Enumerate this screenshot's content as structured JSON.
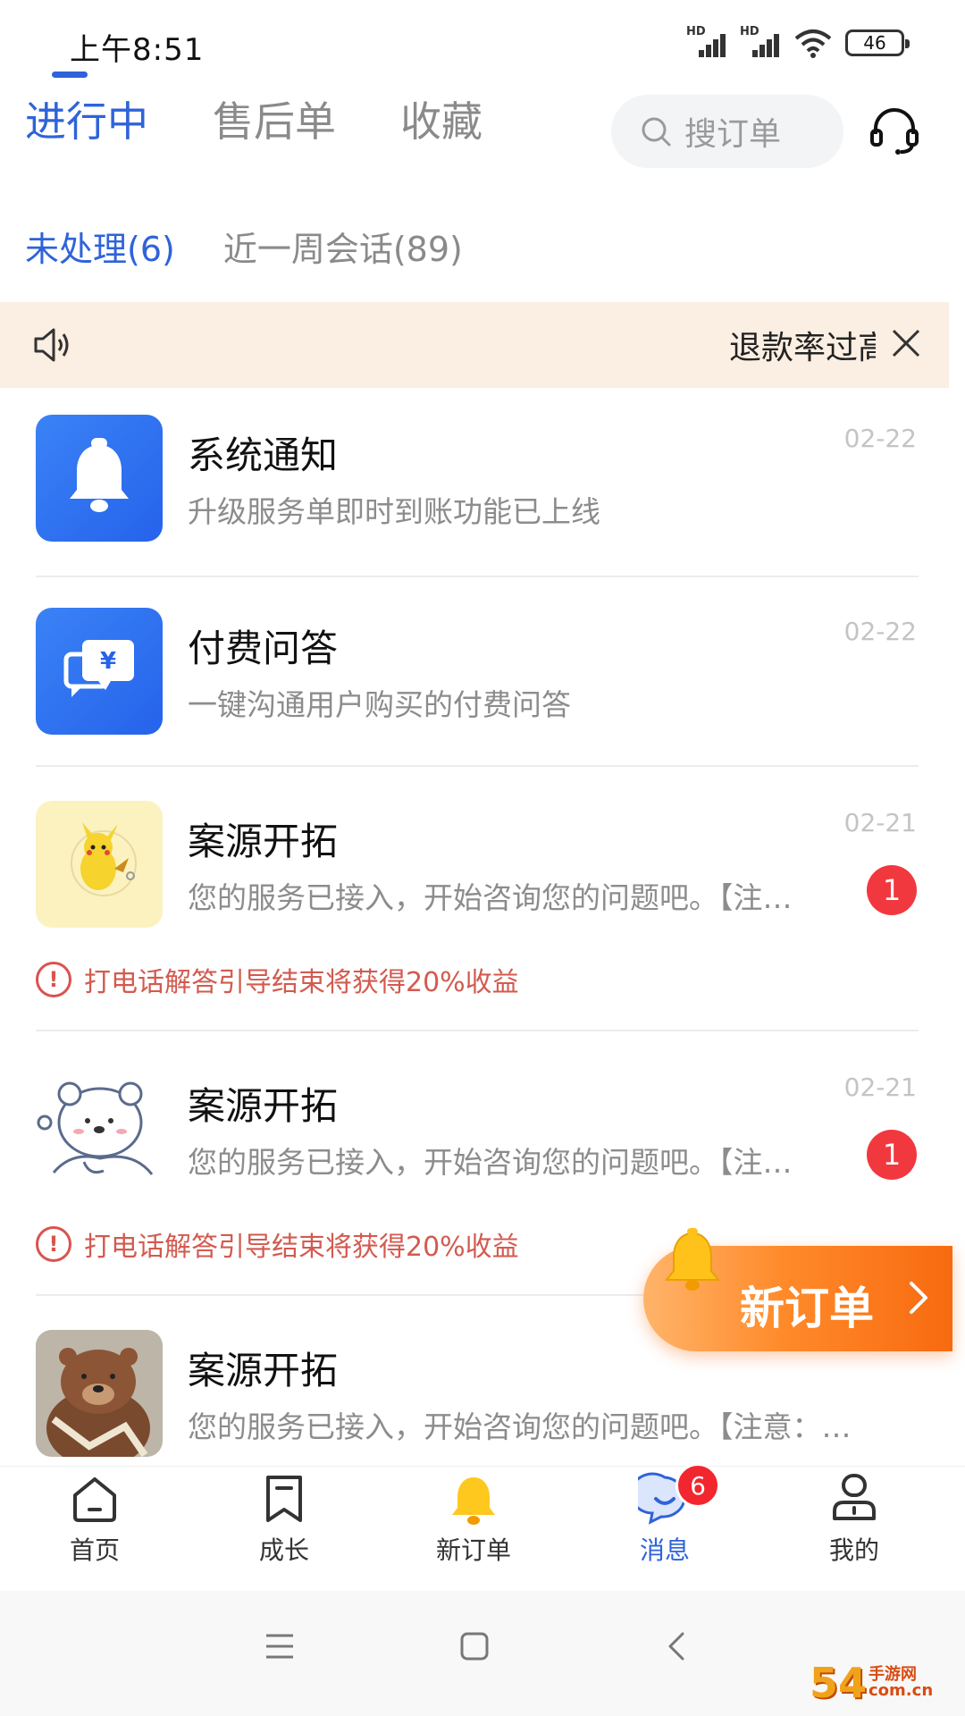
{
  "status_bar": {
    "time": "上午8:51",
    "signal1_label": "HD",
    "signal2_label": "HD",
    "battery": "46"
  },
  "top_tabs": [
    {
      "label": "进行中",
      "active": true
    },
    {
      "label": "售后单",
      "active": false
    },
    {
      "label": "收藏",
      "active": false
    }
  ],
  "search": {
    "placeholder": "搜订单"
  },
  "sub_tabs": [
    {
      "label": "未处理(6)",
      "active": true
    },
    {
      "label": "近一周会话(89)",
      "active": false
    }
  ],
  "notice": {
    "text": "退款率过高"
  },
  "items": [
    {
      "title": "系统通知",
      "subtitle": "升级服务单即时到账功能已上线",
      "date": "02-22",
      "avatar": "bell-icon"
    },
    {
      "title": "付费问答",
      "subtitle": "一键沟通用户购买的付费问答",
      "date": "02-22",
      "avatar": "paid-chat-icon"
    },
    {
      "title": "案源开拓",
      "subtitle": "您的服务已接入，开始咨询您的问题吧。【注…",
      "date": "02-21",
      "unread": "1",
      "warning": "打电话解答引导结束将获得20%收益",
      "avatar": "pikachu-avatar"
    },
    {
      "title": "案源开拓",
      "subtitle": "您的服务已接入，开始咨询您的问题吧。【注…",
      "date": "02-21",
      "unread": "1",
      "warning": "打电话解答引导结束将获得20%收益",
      "avatar": "bear-sketch-avatar"
    },
    {
      "title": "案源开拓",
      "subtitle": "您的服务已接入，开始咨询您的问题吧。【注意：…",
      "date": "",
      "avatar": "brown-bear-avatar"
    }
  ],
  "float_button": {
    "label": "新订单"
  },
  "bottom_nav": [
    {
      "label": "首页",
      "icon": "home-icon"
    },
    {
      "label": "成长",
      "icon": "bookmark-icon"
    },
    {
      "label": "新订单",
      "icon": "bell-icon"
    },
    {
      "label": "消息",
      "icon": "message-icon",
      "badge": "6",
      "active": true
    },
    {
      "label": "我的",
      "icon": "profile-icon"
    }
  ],
  "colors": {
    "accent": "#2e63d9",
    "badge": "#f2383f",
    "warning": "#d35a4f",
    "notice_bg": "#fbeee2",
    "float_orange": "#f86a10"
  },
  "watermark": {
    "number": "54",
    "line1": "手游网",
    "line2": "com.cn"
  }
}
